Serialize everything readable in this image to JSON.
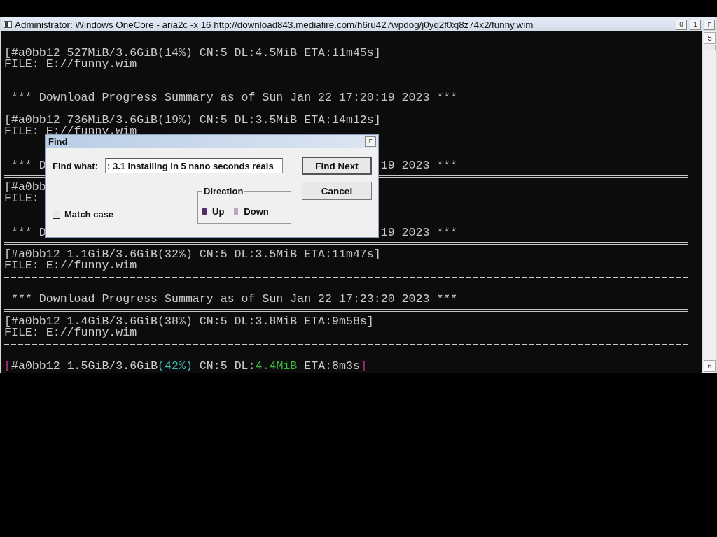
{
  "window": {
    "title": "Administrator:  Windows OneCore - aria2c  -x 16 http://download843.mediafire.com/h6ru427wpdog/j0yq2f0xj8z74x2/funny.wim",
    "buttons": [
      "0",
      "1",
      "r"
    ]
  },
  "console": {
    "lines": [
      {
        "kind": "double"
      },
      {
        "kind": "text",
        "text": "[#a0bb12 527MiB/3.6GiB(14%) CN:5 DL:4.5MiB ETA:11m45s]"
      },
      {
        "kind": "text",
        "text": "FILE: E://funny.wim"
      },
      {
        "kind": "single"
      },
      {
        "kind": "blank"
      },
      {
        "kind": "text",
        "text": " *** Download Progress Summary as of Sun Jan 22 17:20:19 2023 ***"
      },
      {
        "kind": "double"
      },
      {
        "kind": "text",
        "text": "[#a0bb12 736MiB/3.6GiB(19%) CN:5 DL:3.5MiB ETA:14m12s]"
      },
      {
        "kind": "text",
        "text": "FILE: E://funny.wim"
      },
      {
        "kind": "single"
      },
      {
        "kind": "blank"
      },
      {
        "kind": "split",
        "text": " *** D",
        "tail": "19 2023 ***"
      },
      {
        "kind": "double"
      },
      {
        "kind": "text",
        "text": "[#a0bb"
      },
      {
        "kind": "text",
        "text": "FILE:"
      },
      {
        "kind": "single"
      },
      {
        "kind": "blank"
      },
      {
        "kind": "split",
        "text": " *** D",
        "tail": "19 2023 ***"
      },
      {
        "kind": "double"
      },
      {
        "kind": "text",
        "text": "[#a0bb12 1.1GiB/3.6GiB(32%) CN:5 DL:3.5MiB ETA:11m47s]"
      },
      {
        "kind": "text",
        "text": "FILE: E://funny.wim"
      },
      {
        "kind": "single"
      },
      {
        "kind": "blank"
      },
      {
        "kind": "text",
        "text": " *** Download Progress Summary as of Sun Jan 22 17:23:20 2023 ***"
      },
      {
        "kind": "double"
      },
      {
        "kind": "text",
        "text": "[#a0bb12 1.4GiB/3.6GiB(38%) CN:5 DL:3.8MiB ETA:9m58s]"
      },
      {
        "kind": "text",
        "text": "FILE: E://funny.wim"
      },
      {
        "kind": "single"
      },
      {
        "kind": "blank"
      },
      {
        "kind": "colored",
        "segments": [
          {
            "text": "[",
            "color": "#c0308a"
          },
          {
            "text": "#a0bb12 1.5GiB/3.6GiB",
            "color": "#cccccc"
          },
          {
            "text": "(42%)",
            "color": "#3ab8b0"
          },
          {
            "text": " CN:5 DL:",
            "color": "#cccccc"
          },
          {
            "text": "4.4MiB",
            "color": "#3cb83c"
          },
          {
            "text": " ETA:8m3s",
            "color": "#cccccc"
          },
          {
            "text": "]",
            "color": "#c0308a"
          }
        ]
      }
    ]
  },
  "scrollbar": {
    "up": "5",
    "down": "6"
  },
  "find_dialog": {
    "title": "Find",
    "close": "r",
    "find_what_label": "Find what:",
    "find_what_value": ": 3.1 installing in 5 nano seconds reals",
    "match_case": {
      "label": "Match case",
      "checked": false
    },
    "direction": {
      "label": "Direction",
      "options": [
        {
          "label": "Up",
          "selected": true
        },
        {
          "label": "Down",
          "selected": false
        }
      ]
    },
    "buttons": [
      {
        "label": "Find Next",
        "default": true
      },
      {
        "label": "Cancel",
        "default": false
      }
    ]
  }
}
